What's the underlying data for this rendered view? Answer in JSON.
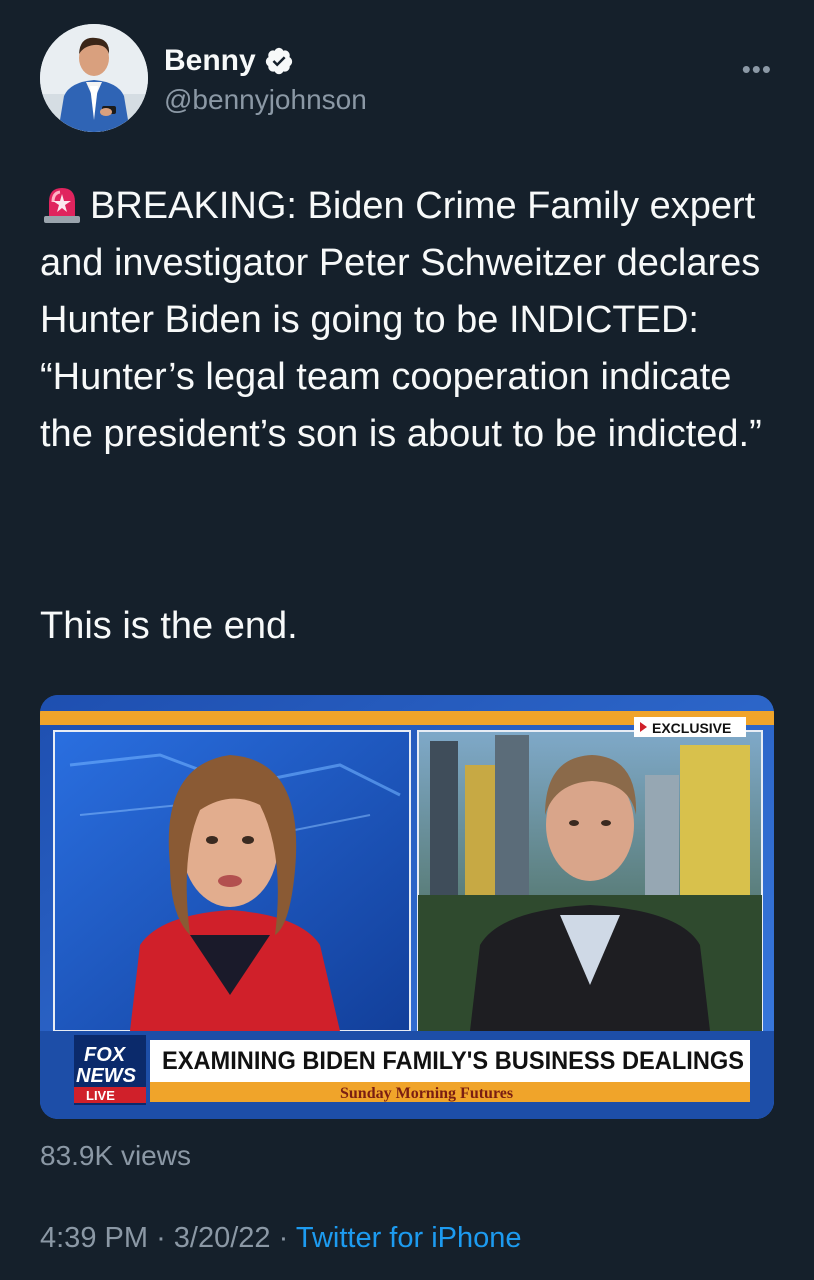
{
  "author": {
    "name": "Benny",
    "handle": "@bennyjohnson",
    "verified": true
  },
  "more_icon": "more-horizontal-icon",
  "tweet": {
    "text_main": "BREAKING: Biden Crime Family expert and investigator Peter Schweitzer declares Hunter Biden is going  to be INDICTED: “Hunter’s legal team cooperation indicate the president’s son is about to be indicted.”",
    "text_closing": "This is the end.",
    "emoji": "rotating-light-icon"
  },
  "media": {
    "badge": "EXCLUSIVE",
    "logo_top": "FOX",
    "logo_bottom": "NEWS",
    "logo_live": "LIVE",
    "headline": "EXAMINING BIDEN FAMILY'S BUSINESS DEALINGS",
    "show": "Sunday Morning Futures"
  },
  "stats": {
    "views": "83.9K views"
  },
  "footer": {
    "time": "4:39 PM",
    "separator": "·",
    "date": "3/20/22",
    "source": "Twitter for iPhone"
  },
  "colors": {
    "background": "#15202b",
    "text": "#f7f9f9",
    "secondary": "#8b98a5",
    "link": "#1d9bf0"
  }
}
